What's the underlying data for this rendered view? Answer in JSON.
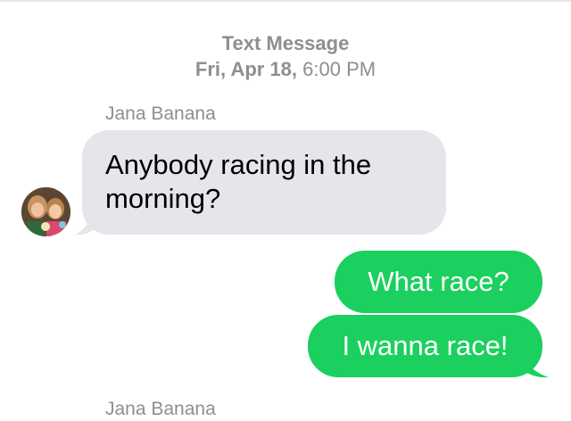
{
  "header": {
    "label": "Text Message",
    "date": "Fri, Apr 18,",
    "time": " 6:00 PM"
  },
  "conversation": {
    "sender_name": "Jana Banana",
    "incoming_message": "Anybody racing in the morning?",
    "outgoing_messages": [
      "What race?",
      "I wanna race!"
    ],
    "next_sender_name": "Jana Banana"
  },
  "colors": {
    "incoming_bubble": "#e5e5ea",
    "outgoing_bubble": "#1bd05e",
    "meta_text": "#8e8e93"
  },
  "icons": {
    "avatar": "contact-photo"
  }
}
